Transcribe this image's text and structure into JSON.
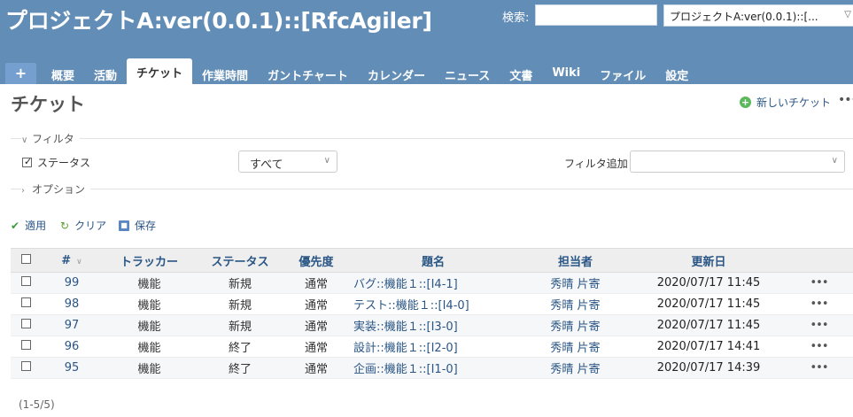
{
  "header": {
    "project_title": "プロジェクトA:ver(0.0.1)::[RfcAgiler]",
    "search_label": "検索:",
    "search_value": "",
    "project_jump": "プロジェクトA:ver(0.0.1)::[..."
  },
  "menu": {
    "new": "+",
    "tabs": [
      {
        "label": "概要"
      },
      {
        "label": "活動"
      },
      {
        "label": "チケット",
        "selected": true
      },
      {
        "label": "作業時間"
      },
      {
        "label": "ガントチャート"
      },
      {
        "label": "カレンダー"
      },
      {
        "label": "ニュース"
      },
      {
        "label": "文書"
      },
      {
        "label": "Wiki"
      },
      {
        "label": "ファイル"
      },
      {
        "label": "設定"
      }
    ]
  },
  "page": {
    "title": "チケット",
    "new_issue": "新しいチケット",
    "more": "•••"
  },
  "filters": {
    "legend": "フィルタ",
    "status_label": "ステータス",
    "status_checked": true,
    "status_operator": "すべて",
    "add_filter_label": "フィルタ追加",
    "add_filter_value": "",
    "options_legend": "オプション"
  },
  "actions": {
    "apply": "適用",
    "clear": "クリア",
    "save": "保存"
  },
  "table": {
    "headers": {
      "id": "#",
      "tracker": "トラッカー",
      "status": "ステータス",
      "priority": "優先度",
      "subject": "題名",
      "assignee": "担当者",
      "updated": "更新日"
    },
    "rows": [
      {
        "id": "99",
        "tracker": "機能",
        "status": "新規",
        "priority": "通常",
        "subject": "バグ::機能１::[I4-1]",
        "assignee": "秀晴 片寄",
        "updated": "2020/07/17 11:45",
        "more": "•••"
      },
      {
        "id": "98",
        "tracker": "機能",
        "status": "新規",
        "priority": "通常",
        "subject": "テスト::機能１::[I4-0]",
        "assignee": "秀晴 片寄",
        "updated": "2020/07/17 11:45",
        "more": "•••"
      },
      {
        "id": "97",
        "tracker": "機能",
        "status": "新規",
        "priority": "通常",
        "subject": "実装::機能１::[I3-0]",
        "assignee": "秀晴 片寄",
        "updated": "2020/07/17 11:45",
        "more": "•••"
      },
      {
        "id": "96",
        "tracker": "機能",
        "status": "終了",
        "priority": "通常",
        "subject": "設計::機能１::[I2-0]",
        "assignee": "秀晴 片寄",
        "updated": "2020/07/17 14:41",
        "more": "•••"
      },
      {
        "id": "95",
        "tracker": "機能",
        "status": "終了",
        "priority": "通常",
        "subject": "企画::機能１::[I1-0]",
        "assignee": "秀晴 片寄",
        "updated": "2020/07/17 14:39",
        "more": "•••"
      }
    ]
  },
  "pagination": "(1-5/5)"
}
